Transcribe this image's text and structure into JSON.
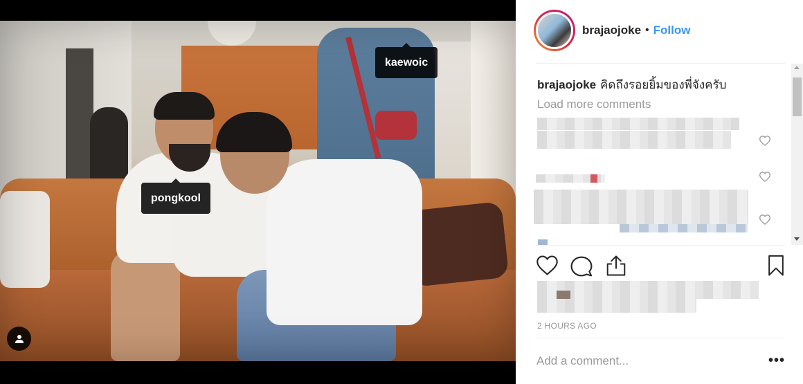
{
  "post": {
    "username": "brajaojoke",
    "separator": "•",
    "follow_label": "Follow",
    "photo_tags": [
      {
        "label": "kaewoic"
      },
      {
        "label": "pongkool"
      }
    ],
    "caption": {
      "username": "brajaojoke",
      "text": "คิดถึงรอยยิ้มของพี่จังครับ"
    },
    "load_more_label": "Load more comments",
    "timestamp": "2 HOURS AGO",
    "add_comment_placeholder": "Add a comment...",
    "more_options_label": "•••"
  },
  "icons": {
    "user_tag": "person-icon",
    "like": "heart-icon",
    "comment": "speech-bubble-icon",
    "share": "share-icon",
    "save": "bookmark-icon",
    "comment_like": "heart-icon",
    "more": "ellipsis-icon"
  },
  "colors": {
    "accent": "#3897f0",
    "text": "#262626",
    "muted": "#999999",
    "media_bg": "#000000"
  }
}
